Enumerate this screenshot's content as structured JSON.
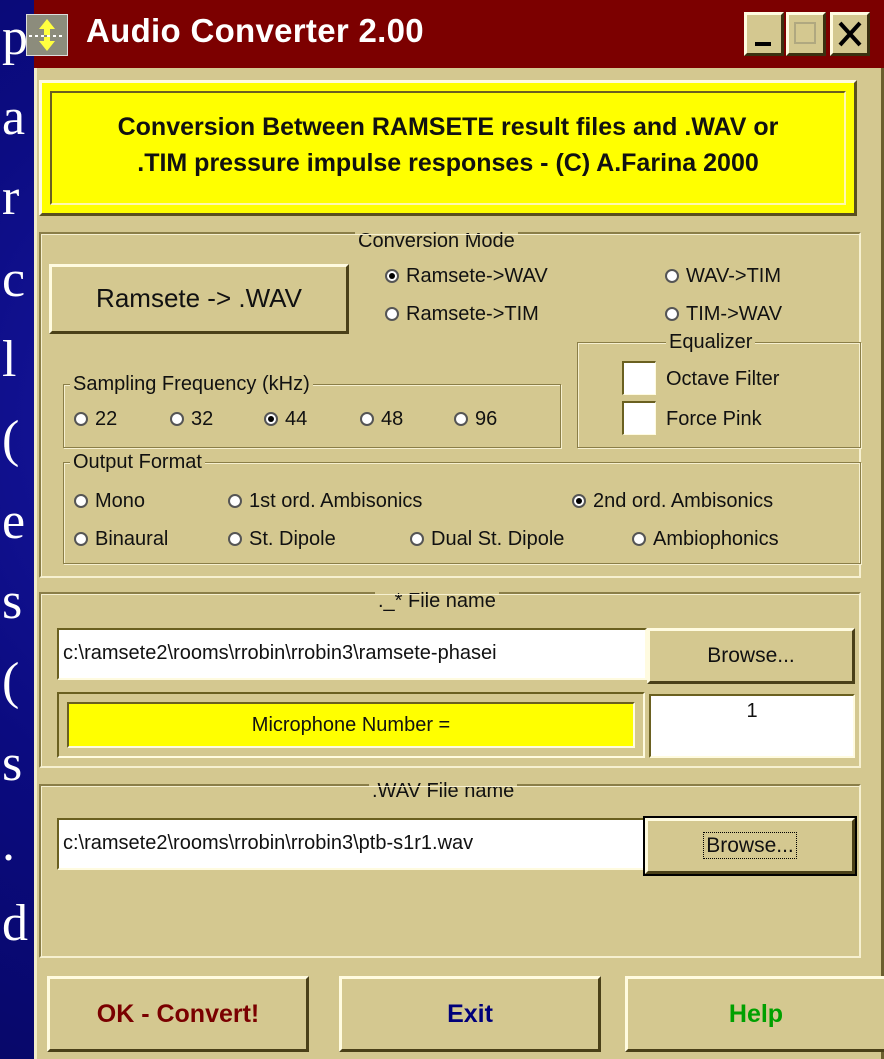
{
  "window": {
    "title": "Audio Converter 2.00",
    "controls": {
      "minimize": "minimize-button",
      "maximize": "maximize-button",
      "close": "close-button"
    }
  },
  "banner": {
    "line1": "Conversion Between RAMSETE result files and .WAV or",
    "line2": ".TIM pressure impulse responses - (C) A.Farina 2000"
  },
  "conversion": {
    "button_label": "Ramsete -> .WAV",
    "group_label": "Conversion Mode",
    "options": [
      {
        "label": "Ramsete->WAV",
        "selected": true
      },
      {
        "label": "WAV->TIM",
        "selected": false
      },
      {
        "label": "Ramsete->TIM",
        "selected": false
      },
      {
        "label": "TIM->WAV",
        "selected": false
      }
    ]
  },
  "equalizer": {
    "group_label": "Equalizer",
    "octave_filter": {
      "label": "Octave Filter",
      "checked": false
    },
    "force_pink": {
      "label": "Force Pink",
      "checked": false
    }
  },
  "sampling": {
    "group_label": "Sampling Frequency (kHz)",
    "options": [
      {
        "label": "22",
        "selected": false
      },
      {
        "label": "32",
        "selected": false
      },
      {
        "label": "44",
        "selected": true
      },
      {
        "label": "48",
        "selected": false
      },
      {
        "label": "96",
        "selected": false
      }
    ]
  },
  "output": {
    "group_label": "Output Format",
    "options": [
      {
        "label": "Mono",
        "selected": false
      },
      {
        "label": "1st ord. Ambisonics",
        "selected": false
      },
      {
        "label": "2nd ord. Ambisonics",
        "selected": true
      },
      {
        "label": "Binaural",
        "selected": false
      },
      {
        "label": "St. Dipole",
        "selected": false
      },
      {
        "label": "Dual St. Dipole",
        "selected": false
      },
      {
        "label": "Ambiophonics",
        "selected": false
      }
    ]
  },
  "source_file": {
    "group_label": "._* File name",
    "path": "c:\\ramsete2\\rooms\\rrobin\\rrobin3\\ramsete-phasei",
    "browse_label": "Browse...",
    "mic_label": "Microphone Number =",
    "mic_value": "1"
  },
  "wav_file": {
    "group_label": ".WAV File name",
    "path": "c:\\ramsete2\\rooms\\rrobin\\rrobin3\\ptb-s1r1.wav",
    "browse_label": "Browse..."
  },
  "actions": {
    "ok_label": "OK - Convert!",
    "exit_label": "Exit",
    "help_label": "Help"
  },
  "colors": {
    "titlebar": "#7c0000",
    "window_bg": "#d4c890",
    "highlight_yellow": "#ffff00",
    "ok_text": "#7a0000",
    "exit_text": "#00007a",
    "help_text": "#00a000",
    "slide_bg": "#0a0a7a"
  },
  "background_slide": {
    "letters": [
      "p",
      "a",
      "r",
      "c",
      "l",
      "(",
      "e",
      "s",
      "(",
      "s",
      ".",
      "d"
    ]
  }
}
